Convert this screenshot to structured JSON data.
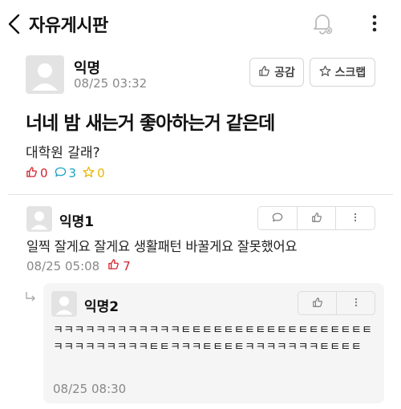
{
  "header": {
    "title": "자유게시판",
    "icons": [
      "chevron-left-icon",
      "bell-off-icon",
      "more-vertical-icon"
    ]
  },
  "post": {
    "author": "익명",
    "date": "08/25 03:32",
    "like_button_label": "공감",
    "scrap_button_label": "스크랩",
    "title": "너네 밤 새는거 좋아하는거 같은데",
    "body": "대학원 갈래?",
    "stats": {
      "likes": "0",
      "comments": "3",
      "scraps": "0"
    }
  },
  "comments": [
    {
      "author": "익명1",
      "body": "일찍 잘게요 잘게요 생활패턴 바꿀게요 잘못했어요",
      "date": "08/25 05:08",
      "likes": "7"
    }
  ],
  "replies": [
    {
      "author": "익명2",
      "body": "ㅋㅋㅋㅋㅋㅋㅋㅋㅋㅋㅋㅋㅌㅌㅌㅌㅌㅌㅌㅌㅌㅌㅌㅌㅌㅌㅌㅌㅌㅌㅋㅋㅋㅋㅋㅋㅋㅋㅋㅌㅌㅋㅋㅋㅌㅌㅌㅌㅋㅋㅋㅋㅋㅋㅋㅌㅌㅌㅌ",
      "date": "08/25 08:30"
    }
  ],
  "colors": {
    "like": "#d0242d",
    "comment": "#1aa3c4",
    "scrap": "#e7b600",
    "muted": "#888888"
  }
}
